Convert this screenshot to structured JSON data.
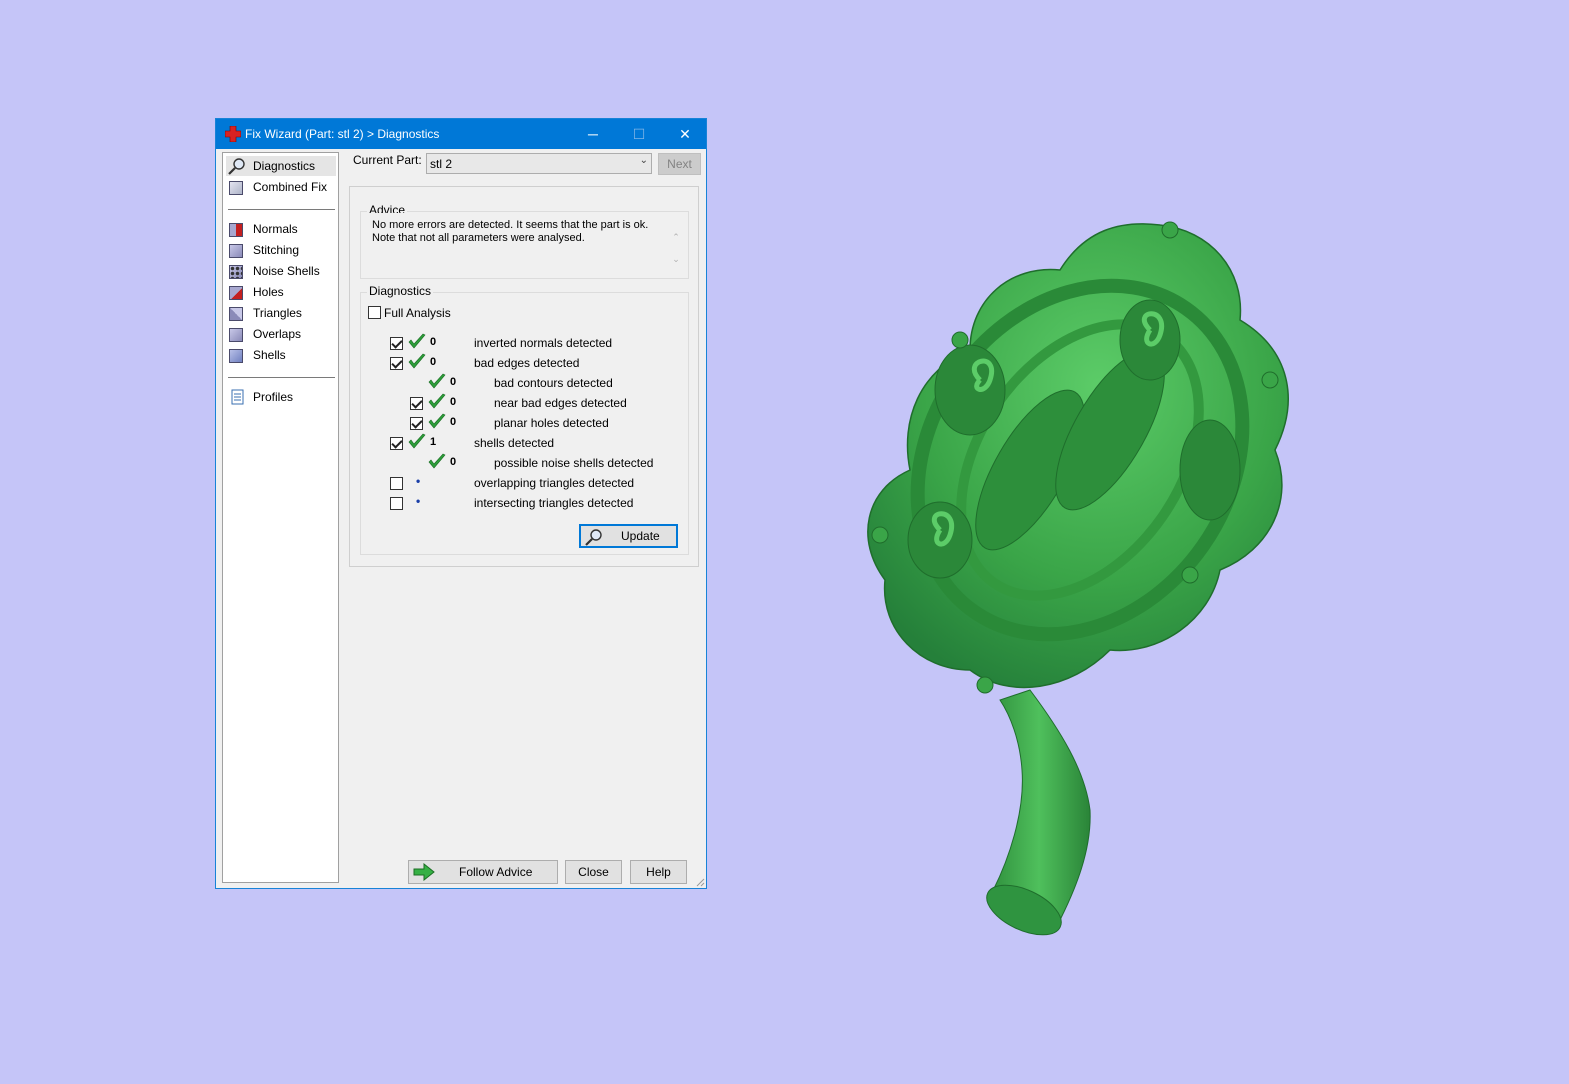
{
  "window": {
    "title": "Fix Wizard (Part: stl 2) > Diagnostics",
    "controls": {
      "minimize": "─",
      "maximize": "☐",
      "close": "✕"
    }
  },
  "sidebar": {
    "items": [
      {
        "label": "Diagnostics",
        "icon": "magnifier-icon",
        "selected": true
      },
      {
        "label": "Combined Fix",
        "icon": "combined-fix-icon"
      },
      {
        "label": "Normals",
        "icon": "normals-icon"
      },
      {
        "label": "Stitching",
        "icon": "stitching-icon"
      },
      {
        "label": "Noise Shells",
        "icon": "noise-shells-icon"
      },
      {
        "label": "Holes",
        "icon": "holes-icon"
      },
      {
        "label": "Triangles",
        "icon": "triangles-icon"
      },
      {
        "label": "Overlaps",
        "icon": "overlaps-icon"
      },
      {
        "label": "Shells",
        "icon": "shells-icon"
      },
      {
        "label": "Profiles",
        "icon": "profiles-icon"
      }
    ]
  },
  "current_part": {
    "label": "Current Part:",
    "value": "stl 2"
  },
  "next_label": "Next",
  "advice": {
    "title": "Advice",
    "line1": "No more errors are detected. It seems that the part is ok.",
    "line2": "Note that not all parameters were analysed.",
    "scroll_up": "⌃",
    "scroll_down": "⌄"
  },
  "diagnostics": {
    "title": "Diagnostics",
    "full_analysis": {
      "label": "Full Analysis",
      "checked": false
    },
    "rows": [
      {
        "checkbox": true,
        "checked": true,
        "status": "ok",
        "count": "0",
        "label": "inverted normals detected",
        "level": 0
      },
      {
        "checkbox": true,
        "checked": true,
        "status": "ok",
        "count": "0",
        "label": "bad edges detected",
        "level": 0
      },
      {
        "checkbox": false,
        "checked": false,
        "status": "ok",
        "count": "0",
        "label": "bad contours detected",
        "level": 1
      },
      {
        "checkbox": true,
        "checked": true,
        "status": "ok",
        "count": "0",
        "label": "near bad edges detected",
        "level": 1
      },
      {
        "checkbox": true,
        "checked": true,
        "status": "ok",
        "count": "0",
        "label": "planar holes detected",
        "level": 1
      },
      {
        "checkbox": true,
        "checked": true,
        "status": "ok",
        "count": "1",
        "label": "shells detected",
        "level": 0
      },
      {
        "checkbox": false,
        "checked": false,
        "status": "ok",
        "count": "0",
        "label": "possible noise shells detected",
        "level": 1
      },
      {
        "checkbox": true,
        "checked": false,
        "status": "not-analysed",
        "count": "•",
        "label": "overlapping triangles detected",
        "level": 0
      },
      {
        "checkbox": true,
        "checked": false,
        "status": "not-analysed",
        "count": "•",
        "label": "intersecting triangles detected",
        "level": 0
      }
    ],
    "update_label": "Update"
  },
  "footer": {
    "follow_advice": "Follow Advice",
    "close": "Close",
    "help": "Help"
  },
  "colors": {
    "background": "#c5c5f8",
    "titlebar": "#0078d7",
    "model_green": "#3fa84f",
    "check_green": "#2d9e3a"
  }
}
